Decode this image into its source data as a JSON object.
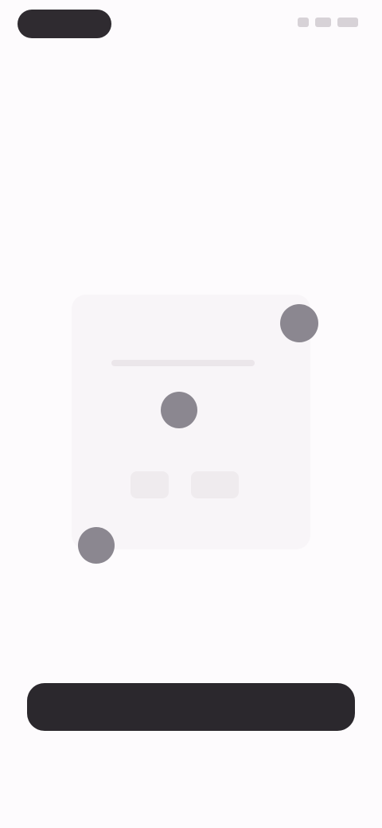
{
  "status_bar": {
    "icons": [
      "signal-icon",
      "wifi-icon",
      "battery-icon"
    ]
  },
  "hero": {
    "title": "",
    "subtitle": ""
  },
  "cta": {
    "label": ""
  },
  "secondary_link": {
    "label": ""
  },
  "colors": {
    "background": "#fdfbfd",
    "button": "#2b282d",
    "dot": "#8b8790",
    "pill": "#2f2b30"
  }
}
